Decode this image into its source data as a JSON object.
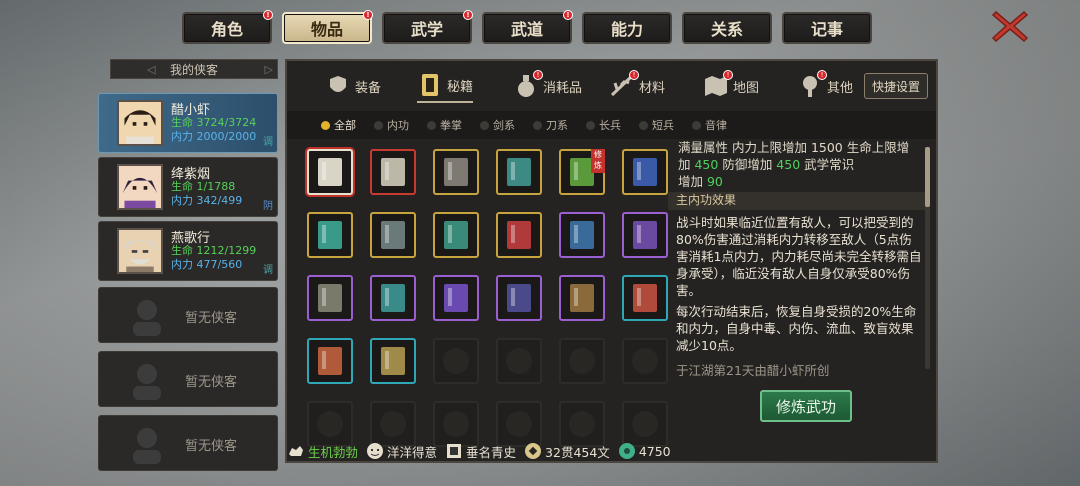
{
  "top_tabs": [
    {
      "label": "角色",
      "badge": true,
      "active": false
    },
    {
      "label": "物品",
      "badge": true,
      "active": true
    },
    {
      "label": "武学",
      "badge": true,
      "active": false
    },
    {
      "label": "武道",
      "badge": true,
      "active": false
    },
    {
      "label": "能力",
      "badge": false,
      "active": false
    },
    {
      "label": "关系",
      "badge": false,
      "active": false
    },
    {
      "label": "记事",
      "badge": false,
      "active": false
    }
  ],
  "left_panel": {
    "header": "我的侠客",
    "characters": [
      {
        "name": "醋小虾",
        "hp": "生命 3724/3724",
        "mp": "内力 2000/2000",
        "tag": "调",
        "active": true
      },
      {
        "name": "绛紫烟",
        "hp": "生命 1/1788",
        "mp": "内力 342/499",
        "tag": "阴",
        "active": false
      },
      {
        "name": "燕歌行",
        "hp": "生命 1212/1299",
        "mp": "内力 477/560",
        "tag": "调",
        "active": false
      }
    ],
    "empty_label": "暂无侠客"
  },
  "categories": [
    {
      "label": "装备",
      "icon": "armor-icon",
      "badge": false
    },
    {
      "label": "秘籍",
      "icon": "scroll-icon",
      "badge": false,
      "active": true
    },
    {
      "label": "消耗品",
      "icon": "potion-icon",
      "badge": true
    },
    {
      "label": "材料",
      "icon": "herb-icon",
      "badge": true
    },
    {
      "label": "地图",
      "icon": "map-icon",
      "badge": true
    },
    {
      "label": "其他",
      "icon": "lantern-icon",
      "badge": true
    }
  ],
  "quick_settings": "快捷设置",
  "sub_filters": [
    "全部",
    "内功",
    "拳掌",
    "剑系",
    "刀系",
    "长兵",
    "短兵",
    "音律"
  ],
  "grid": {
    "items": [
      {
        "frame": "white",
        "color": "#d9d4c6",
        "selected": true
      },
      {
        "frame": "red",
        "color": "#bdb7a8"
      },
      {
        "frame": "gold",
        "color": "#7e7a72"
      },
      {
        "frame": "gold",
        "color": "#3d8a84"
      },
      {
        "frame": "gold",
        "color": "#5a9a3a",
        "tag": "修炼"
      },
      {
        "frame": "gold",
        "color": "#3a5aa8"
      },
      {
        "frame": "gold",
        "color": "#3a9a8a"
      },
      {
        "frame": "gold",
        "color": "#6a7a7a"
      },
      {
        "frame": "gold",
        "color": "#3a8a7a"
      },
      {
        "frame": "gold",
        "color": "#b03a3a"
      },
      {
        "frame": "purple",
        "color": "#3a6a9a"
      },
      {
        "frame": "purple",
        "color": "#6a4aa0"
      },
      {
        "frame": "purple",
        "color": "#7a7a6a"
      },
      {
        "frame": "purple",
        "color": "#3a8a8a"
      },
      {
        "frame": "purple",
        "color": "#6a4ab0"
      },
      {
        "frame": "purple",
        "color": "#4a4a8a"
      },
      {
        "frame": "purple",
        "color": "#8a6a3a"
      },
      {
        "frame": "teal",
        "color": "#b04a3a"
      },
      {
        "frame": "teal",
        "color": "#b05a3a"
      },
      {
        "frame": "teal",
        "color": "#a08a4a"
      }
    ]
  },
  "detail": {
    "attr_line1_pre": "满量属性  内力上限增加 1500  生命上限增",
    "attr_line2_a": "加 ",
    "attr_line2_v1": "450",
    "attr_line2_b": " 防御增加 ",
    "attr_line2_v2": "450",
    "attr_line2_c": " 武学常识",
    "attr_line3_a": "增加 ",
    "attr_line3_v": "90",
    "section": "主内功效果",
    "body": "战斗时如果临近位置有敌人，可以把受到的80%伤害通过消耗内力转移至敌人（5点伤害消耗1点内力，内力耗尽尚未完全转移需自身承受），临近没有敌人自身仅承受80%伤害。",
    "body2": "每次行动结束后，恢复自身受损的20%生命和内力，自身中毒、内伤、流血、致盲效果减少10点。",
    "foot": "于江湖第21天由醋小虾所创"
  },
  "train_button": "修炼武功",
  "status": {
    "vitality": "生机勃勃",
    "mood": "洋洋得意",
    "fame": "垂名青史",
    "money": "32贯454文",
    "gems": "4750"
  },
  "colors": {
    "accent_gold": "#c7a43e",
    "hp_green": "#57d05a",
    "mp_blue": "#5ab2e8",
    "badge_red": "#d9262a"
  }
}
